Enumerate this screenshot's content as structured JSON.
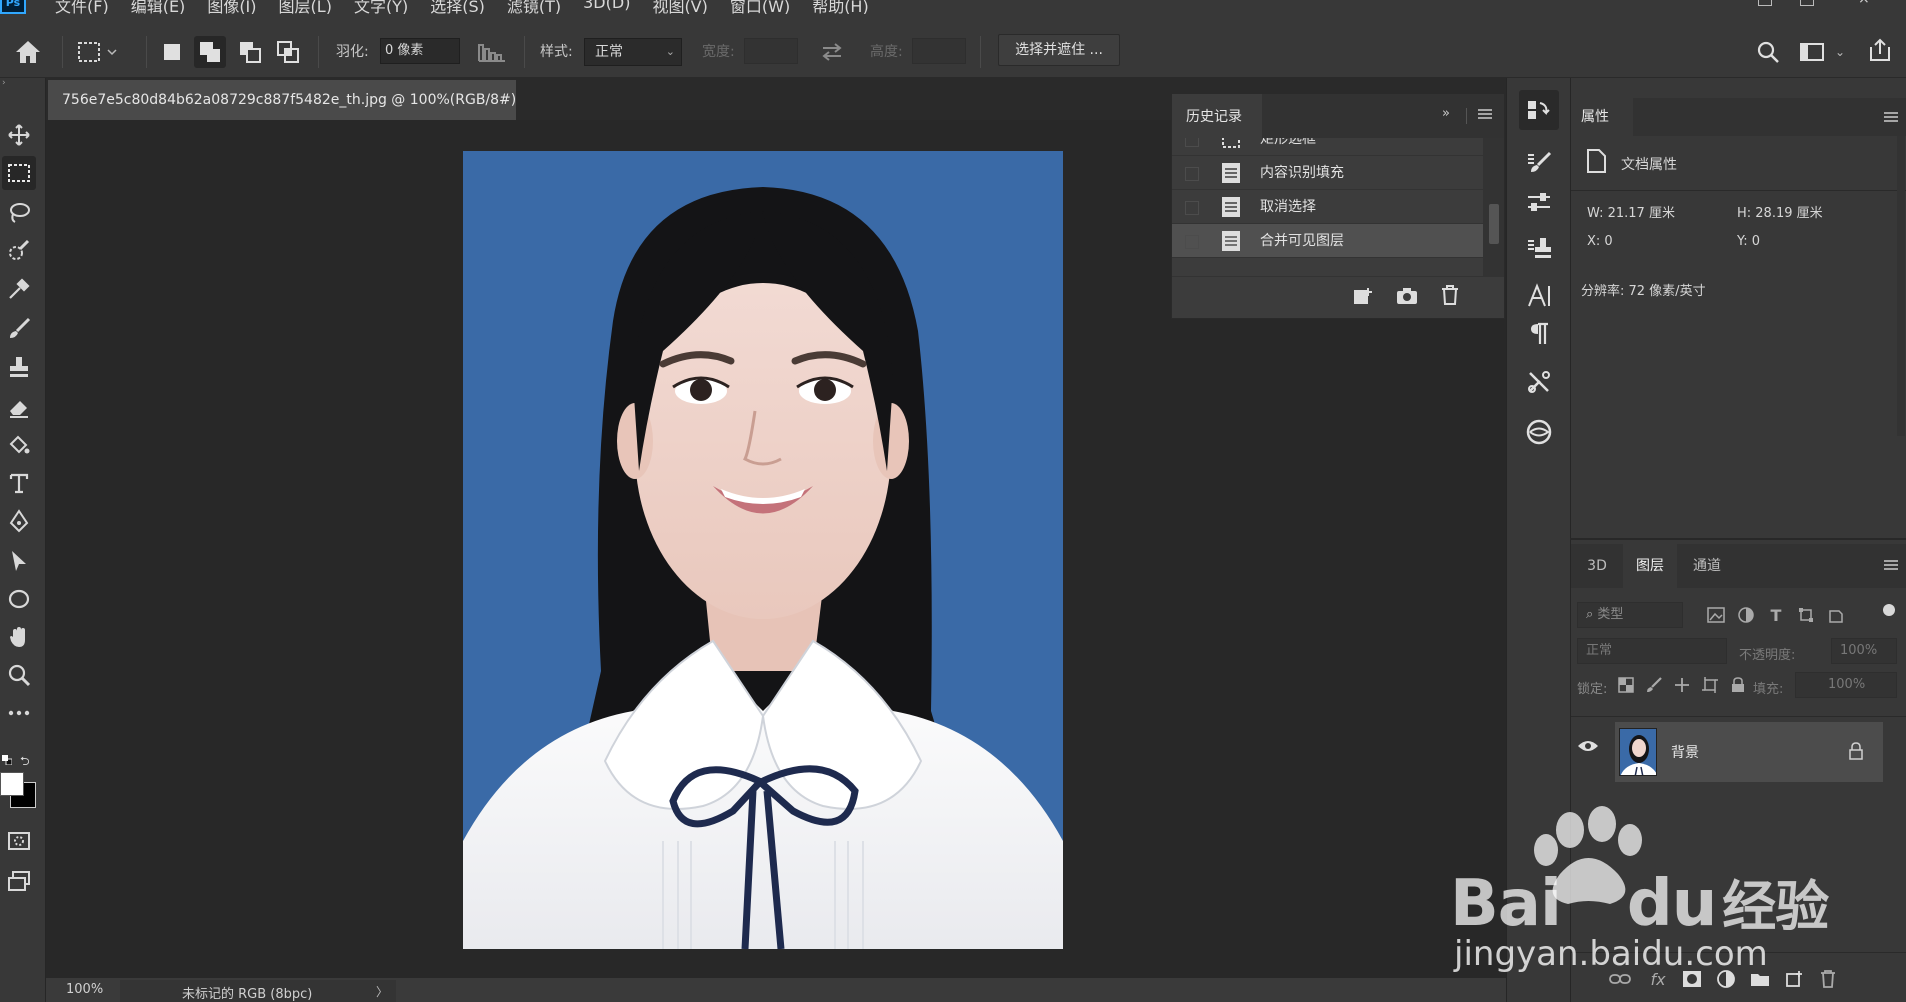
{
  "app": {
    "logo": "Ps"
  },
  "menu": [
    "文件(F)",
    "编辑(E)",
    "图像(I)",
    "图层(L)",
    "文字(Y)",
    "选择(S)",
    "滤镜(T)",
    "3D(D)",
    "视图(V)",
    "窗口(W)",
    "帮助(H)"
  ],
  "options": {
    "feather_label": "羽化:",
    "feather_value": "0 像素",
    "style_label": "样式:",
    "style_value": "正常",
    "width_label": "宽度:",
    "height_label": "高度:",
    "select_mask_button": "选择并遮住 ..."
  },
  "document": {
    "tab_title": "756e7e5c80d84b62a08729c887f5482e_th.jpg @ 100%(RGB/8#)",
    "tab_close": "×",
    "zoom": "100%",
    "color_profile": "未标记的 RGB (8bpc)",
    "status_arrow": "〉"
  },
  "history": {
    "title": "历史记录",
    "items": [
      {
        "label": "矩形选框",
        "selected": false
      },
      {
        "label": "内容识别填充",
        "selected": false
      },
      {
        "label": "取消选择",
        "selected": false
      },
      {
        "label": "合并可见图层",
        "selected": true
      }
    ]
  },
  "properties": {
    "title": "属性",
    "doc_props": "文档属性",
    "w": "W:  21.17 厘米",
    "h": "H:  28.19 厘米",
    "x": "X:  0",
    "y": "Y:  0",
    "resolution": "分辨率: 72 像素/英寸"
  },
  "layers": {
    "tabs": [
      "3D",
      "图层",
      "通道"
    ],
    "filter_placeholder": "类型",
    "blend_mode": "正常",
    "opacity_label": "不透明度:",
    "opacity_value": "100%",
    "lock_label": "锁定:",
    "fill_label": "填充:",
    "fill_value": "100%",
    "layer_name": "背景"
  },
  "colors": {
    "photo_bg": "#3a6aa7",
    "panel": "#383838",
    "accent": "#31a8ff"
  },
  "watermark": {
    "brand": "Bai",
    "brand2": "du",
    "cn": "经验",
    "url": "jingyan.baidu.com"
  }
}
